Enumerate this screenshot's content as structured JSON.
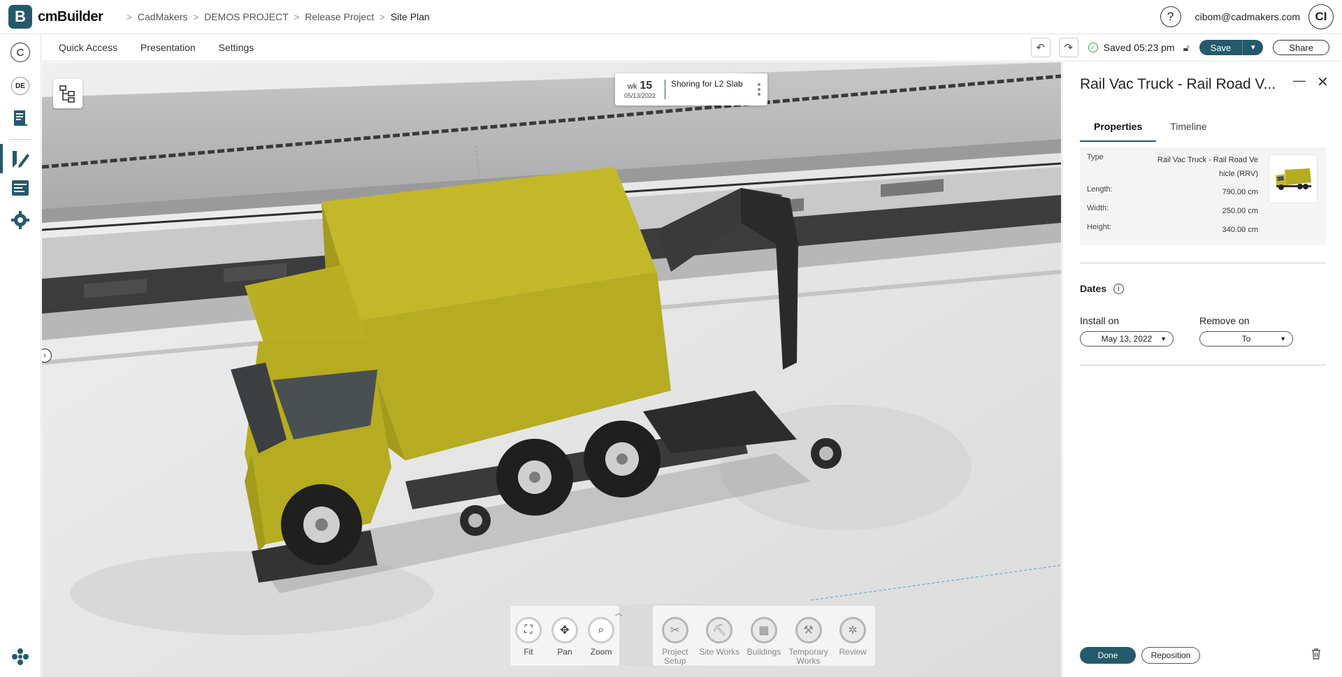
{
  "app": {
    "logo_letter": "B",
    "name": "cmBuilder"
  },
  "breadcrumb": [
    "CadMakers",
    "DEMOS PROJECT",
    "Release Project",
    "Site Plan"
  ],
  "user": {
    "email": "cibom@cadmakers.com",
    "initials": "CI",
    "help": "?"
  },
  "rail": {
    "company_initial": "C",
    "project_initials": "DE"
  },
  "toolbar": {
    "menu": [
      "Quick Access",
      "Presentation",
      "Settings"
    ],
    "saved_text": "Saved 05:23 pm",
    "save_label": "Save",
    "share_label": "Share"
  },
  "schedule": {
    "wk_prefix": "wk",
    "week": "15",
    "date": "05/13/2022",
    "task": "Shoring for L2 Slab"
  },
  "nav_controls": [
    "Fit",
    "Pan",
    "Zoom"
  ],
  "layer_controls": [
    "Project Setup",
    "Site Works",
    "Buildings",
    "Temporary Works",
    "Review"
  ],
  "panel": {
    "title": "Rail Vac Truck - Rail Road V...",
    "tabs": [
      "Properties",
      "Timeline"
    ],
    "properties": [
      {
        "key": "Type",
        "value": "Rail Vac Truck - Rail Road Ve hicle (RRV)"
      },
      {
        "key": "Length:",
        "value": "790.00 cm"
      },
      {
        "key": "Width:",
        "value": "250.00 cm"
      },
      {
        "key": "Height:",
        "value": "340.00 cm"
      }
    ],
    "dates_title": "Dates",
    "install_label": "Install on",
    "install_value": "May 13, 2022",
    "remove_label": "Remove on",
    "remove_value": "To",
    "done_label": "Done",
    "reposition_label": "Reposition"
  },
  "colors": {
    "brand": "#245a6b",
    "truck_body": "#b5ac21",
    "saved_check": "#3aa55a"
  }
}
